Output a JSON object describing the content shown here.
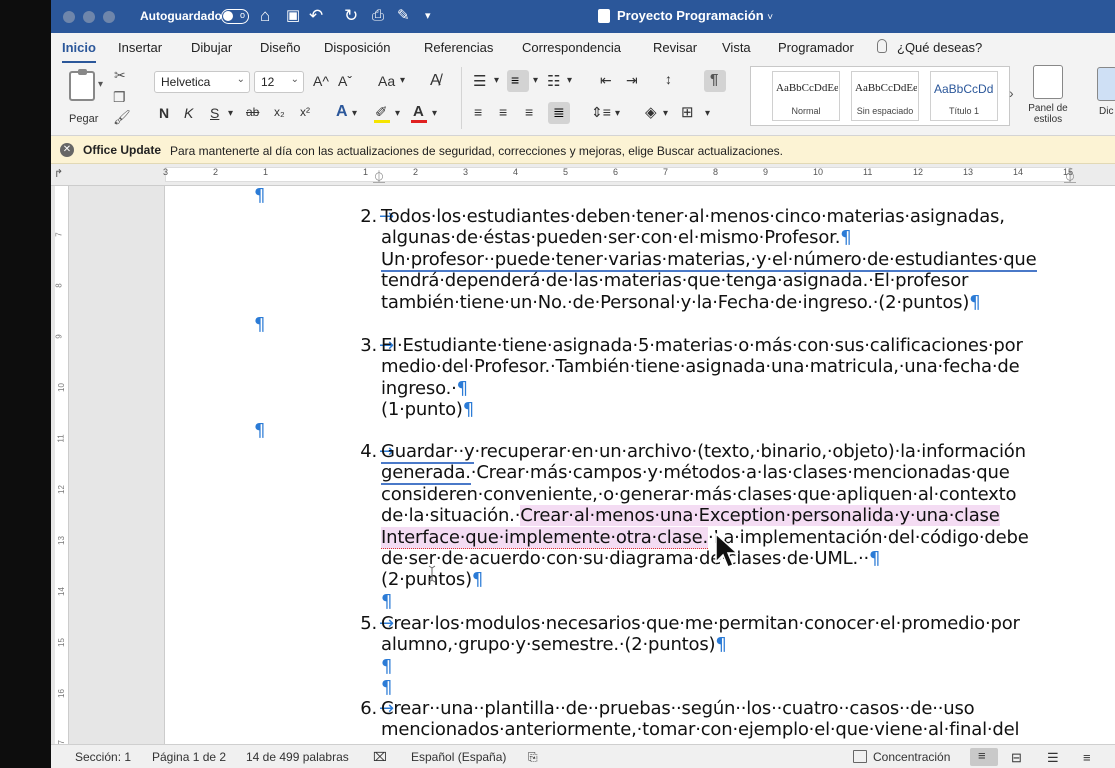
{
  "titlebar": {
    "autosave_label": "Autoguardado",
    "autosave_state": "o",
    "doc_title": "Proyecto Programación",
    "doc_title_chevron": "˅"
  },
  "tabs": [
    "Inicio",
    "Insertar",
    "Dibujar",
    "Diseño",
    "Disposición",
    "Referencias",
    "Correspondencia",
    "Revisar",
    "Vista",
    "Programador"
  ],
  "tell_me": "¿Qué deseas?",
  "ribbon": {
    "paste_label": "Pegar",
    "font_name": "Helvetica",
    "font_size": "12",
    "grow_font": "A^",
    "shrink_font": "Aˇ",
    "change_case": "Aa",
    "bold": "N",
    "italic": "K",
    "underline": "S",
    "strikethrough": "ab",
    "subscript": "x₂",
    "superscript": "x²",
    "styles": [
      {
        "sample": "AaBbCcDdEe",
        "name": "Normal"
      },
      {
        "sample": "AaBbCcDdEe",
        "name": "Sin espaciado"
      },
      {
        "sample": "AaBbCcDd",
        "name": "Título 1"
      }
    ],
    "styles_pane": "Panel de estilos",
    "dictate_partial": "Dic"
  },
  "update_bar": {
    "title": "Office Update",
    "message": "Para mantenerte al día con las actualizaciones de seguridad, correcciones y mejoras, elige Buscar actualizaciones."
  },
  "ruler": {
    "numbers": [
      "3",
      "2",
      "1",
      "1",
      "2",
      "3",
      "4",
      "5",
      "6",
      "7",
      "8",
      "9",
      "10",
      "11",
      "12",
      "13",
      "14",
      "15"
    ],
    "vertical": [
      "7",
      "8",
      "9",
      "10",
      "11",
      "12",
      "13",
      "14",
      "15",
      "16",
      "17"
    ]
  },
  "document": {
    "item2": {
      "num": "2.",
      "lines": [
        "Todos·los·estudiantes·deben·tener·al·menos·cinco·materias·asignadas,",
        "algunas·de·éstas·pueden·ser·con·el·mismo·Profesor.",
        "Un·profesor··puede·tener·varias·materias,·y·el·número·de·estudiantes·que",
        "tendrá·dependerá·de·las·materias·que·tenga·asignada.·El·profesor",
        "también·tiene·un·No.·de·Personal·y·la·Fecha·de·ingreso.·(2·puntos)"
      ]
    },
    "item3": {
      "num": "3.",
      "lines": [
        "El·Estudiante·tiene·asignada·5·materias·o·más·con·sus·calificaciones·por",
        "medio·del·Profesor.·También·tiene·asignada·una·matricula,·una·fecha·de",
        "ingreso.·",
        "(1·punto)"
      ]
    },
    "item4": {
      "num": "4.",
      "line1a": "Guardar··y",
      "line1b": "·recuperar·en·un·archivo·(texto,·binario,·objeto)·la·información",
      "line2a": "generada.",
      "line2b": "·Crear·más·campos·y·métodos·a·las·clases·mencionadas·que",
      "line3": "consideren·conveniente,·o·generar·más·clases·que·apliquen·al·contexto",
      "line4a": "de·la·situación.·",
      "line4b": "Crear·al·menos·una·Exception·personalida·y·una·clase",
      "line5a": "Interface·que·implemente·otra·clase.",
      "line5b": "·La·implementación·del·código·debe",
      "line6": "de·ser·de·acuerdo·con·su·diagrama·de·clases·de·UML.··",
      "line7": "(2·puntos)"
    },
    "item5": {
      "num": "5.",
      "lines": [
        "Crear·los·modulos·necesarios·que·me·permitan·conocer·el·promedio·por",
        "alumno,·grupo·y·semestre.·(2·puntos)"
      ]
    },
    "item6": {
      "num": "6.",
      "lines": [
        "Crear··una··plantilla··de··pruebas··según··los··cuatro··casos··de··uso",
        "mencionados·anteriormente,·tomar·con·ejemplo·el·que·viene·al·final·del"
      ]
    },
    "pilcrow": "¶",
    "tab_arrow": "→"
  },
  "status_bar": {
    "section": "Sección: 1",
    "page": "Página 1 de 2",
    "words": "14 de 499 palabras",
    "language": "Español (España)",
    "focus": "Concentración"
  }
}
